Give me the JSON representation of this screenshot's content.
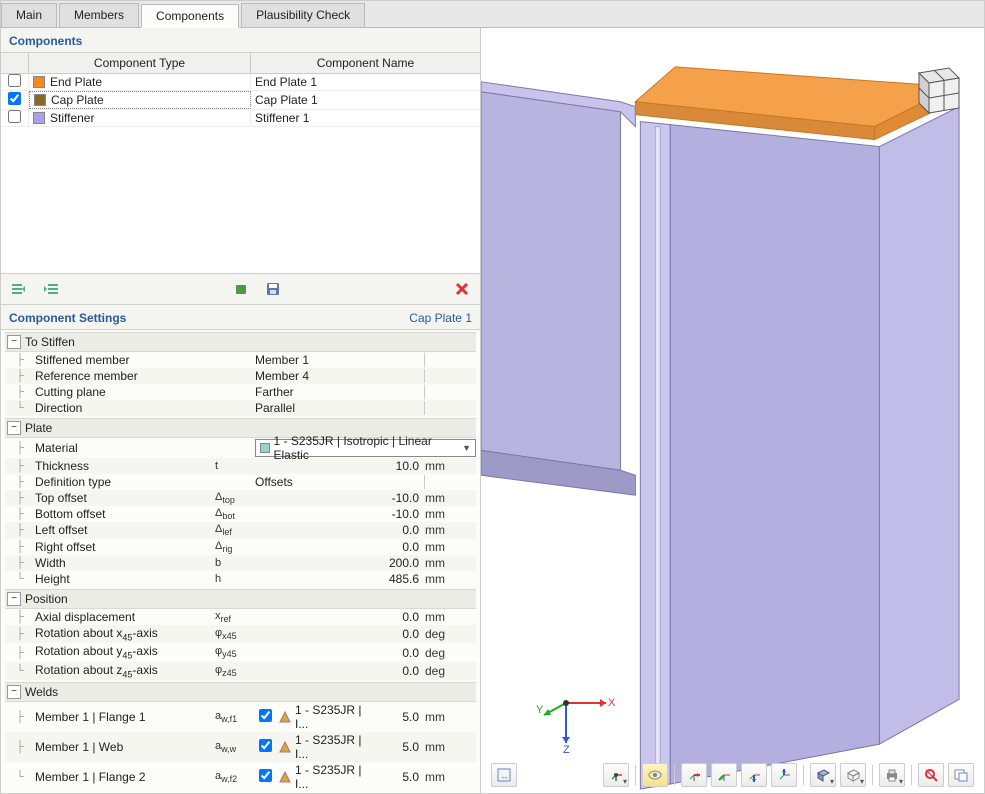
{
  "tabs": {
    "main": "Main",
    "members": "Members",
    "components": "Components",
    "plausibility": "Plausibility Check",
    "active": "Components"
  },
  "panels": {
    "components_title": "Components",
    "settings_title": "Component Settings",
    "settings_name": "Cap Plate 1"
  },
  "grid": {
    "header_type": "Component Type",
    "header_name": "Component Name",
    "rows": [
      {
        "checked": false,
        "color": "#f28a1e",
        "type": "End Plate",
        "name": "End Plate 1"
      },
      {
        "checked": true,
        "color": "#8a6a2b",
        "type": "Cap Plate",
        "name": "Cap Plate 1"
      },
      {
        "checked": false,
        "color": "#a9a3e6",
        "type": "Stiffener",
        "name": "Stiffener 1"
      }
    ]
  },
  "groups": {
    "to_stiffen": {
      "title": "To Stiffen",
      "items": [
        {
          "label": "Stiffened member",
          "value": "Member 1"
        },
        {
          "label": "Reference member",
          "value": "Member 4"
        },
        {
          "label": "Cutting plane",
          "value": "Farther"
        },
        {
          "label": "Direction",
          "value": "Parallel"
        }
      ]
    },
    "plate": {
      "title": "Plate",
      "material_label": "Material",
      "material_value": "1 - S235JR | Isotropic | Linear Elastic",
      "material_swatch": "#8fd6d0",
      "rows": [
        {
          "label": "Thickness",
          "symbol": "t",
          "value": "10.0",
          "unit": "mm"
        },
        {
          "label": "Definition type",
          "symbol": "",
          "value_left": "Offsets",
          "unit": ""
        },
        {
          "label": "Top offset",
          "symbol": "Δtop",
          "value": "-10.0",
          "unit": "mm"
        },
        {
          "label": "Bottom offset",
          "symbol": "Δbot",
          "value": "-10.0",
          "unit": "mm"
        },
        {
          "label": "Left offset",
          "symbol": "Δlef",
          "value": "0.0",
          "unit": "mm"
        },
        {
          "label": "Right offset",
          "symbol": "Δrig",
          "value": "0.0",
          "unit": "mm"
        },
        {
          "label": "Width",
          "symbol": "b",
          "value": "200.0",
          "unit": "mm"
        },
        {
          "label": "Height",
          "symbol": "h",
          "value": "485.6",
          "unit": "mm"
        }
      ]
    },
    "position": {
      "title": "Position",
      "rows": [
        {
          "label": "Axial displacement",
          "symbol": "xref",
          "value": "0.0",
          "unit": "mm"
        },
        {
          "label": "Rotation about x45-axis",
          "symbol": "φx45",
          "value": "0.0",
          "unit": "deg"
        },
        {
          "label": "Rotation about y45-axis",
          "symbol": "φy45",
          "value": "0.0",
          "unit": "deg"
        },
        {
          "label": "Rotation about z45-axis",
          "symbol": "φz45",
          "value": "0.0",
          "unit": "deg"
        }
      ]
    },
    "welds": {
      "title": "Welds",
      "rows": [
        {
          "label": "Member 1 | Flange 1",
          "symbol": "aw,f1",
          "checked": true,
          "mat": "1 - S235JR | I...",
          "value": "5.0",
          "unit": "mm"
        },
        {
          "label": "Member 1 | Web",
          "symbol": "aw,w",
          "checked": true,
          "mat": "1 - S235JR | I...",
          "value": "5.0",
          "unit": "mm"
        },
        {
          "label": "Member 1 | Flange 2",
          "symbol": "aw,f2",
          "checked": true,
          "mat": "1 - S235JR | I...",
          "value": "5.0",
          "unit": "mm"
        }
      ]
    }
  },
  "axis": {
    "x": "X",
    "y": "Y",
    "z": "Z"
  }
}
